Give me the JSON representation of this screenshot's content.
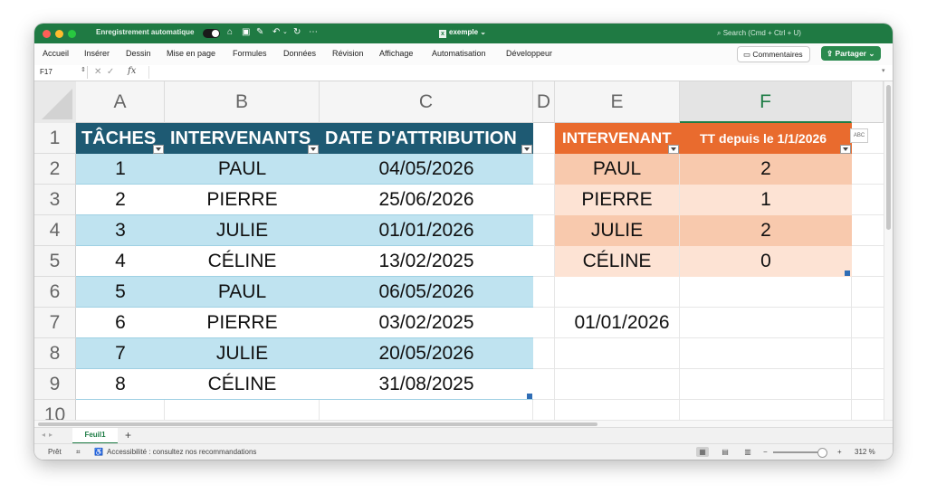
{
  "titlebar": {
    "autosave_label": "Enregistrement automatique",
    "document_title": "exemple",
    "search_placeholder": "Search (Cmd + Ctrl + U)"
  },
  "menu": [
    "Accueil",
    "Insérer",
    "Dessin",
    "Mise en page",
    "Formules",
    "Données",
    "Révision",
    "Affichage",
    "Automatisation",
    "Développeur"
  ],
  "buttons": {
    "comments": "Commentaires",
    "share": "Partager"
  },
  "formula_bar": {
    "name_box": "F17",
    "fx": "fx",
    "value": ""
  },
  "columns": [
    "A",
    "B",
    "C",
    "D",
    "E",
    "F"
  ],
  "rows": [
    "1",
    "2",
    "3",
    "4",
    "5",
    "6",
    "7",
    "8",
    "9",
    "10"
  ],
  "tasks_table": {
    "headers": [
      "TÂCHES",
      "INTERVENANTS",
      "DATE D'ATTRIBUTION"
    ],
    "rows": [
      [
        "1",
        "PAUL",
        "04/05/2026"
      ],
      [
        "2",
        "PIERRE",
        "25/06/2026"
      ],
      [
        "3",
        "JULIE",
        "01/01/2026"
      ],
      [
        "4",
        "CÉLINE",
        "13/02/2025"
      ],
      [
        "5",
        "PAUL",
        "06/05/2026"
      ],
      [
        "6",
        "PIERRE",
        "03/02/2025"
      ],
      [
        "7",
        "JULIE",
        "20/05/2026"
      ],
      [
        "8",
        "CÉLINE",
        "31/08/2025"
      ]
    ],
    "color": "#1e5a73"
  },
  "summary_table": {
    "headers": [
      "INTERVENANT",
      "TT depuis le 1/1/2026"
    ],
    "rows": [
      [
        "PAUL",
        "2"
      ],
      [
        "PIERRE",
        "1"
      ],
      [
        "JULIE",
        "2"
      ],
      [
        "CÉLINE",
        "0"
      ]
    ],
    "color": "#e96b2e"
  },
  "reference_date": "01/01/2026",
  "sheet_tabs": [
    "Feuil1"
  ],
  "status": {
    "ready": "Prêt",
    "accessibility": "Accessibilité : consultez nos recommandations",
    "zoom": "312 %"
  },
  "icons": {
    "home": "home-icon",
    "save": "save-icon",
    "undo": "undo-icon",
    "redo": "redo-icon",
    "more": "more-icon",
    "search": "search-icon",
    "comment": "comment-icon",
    "share": "share-icon"
  }
}
